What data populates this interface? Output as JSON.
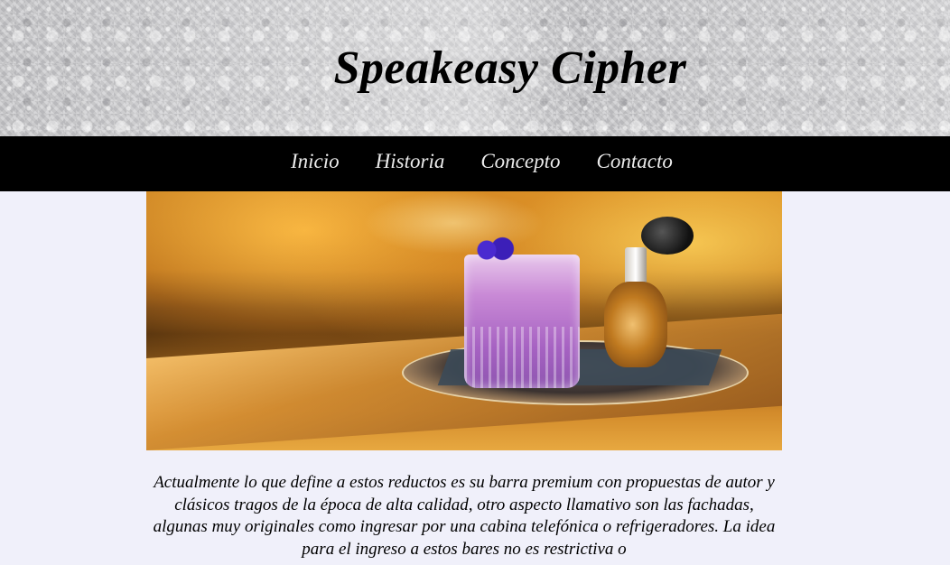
{
  "header": {
    "title": "Speakeasy Cipher"
  },
  "nav": {
    "items": [
      "Inicio",
      "Historia",
      "Concepto",
      "Contacto"
    ]
  },
  "hero": {
    "alt": "Purple cocktail with flower garnish next to a perfume atomizer on a silver tray"
  },
  "content": {
    "paragraph": "Actualmente lo que define a estos reductos es su barra premium con propuestas de autor y clásicos tragos de la época de alta calidad, otro aspecto llamativo son las fachadas, algunas muy originales como ingresar por una cabina telefónica o refrigeradores. La idea para el ingreso a estos bares no es restrictiva o"
  },
  "colors": {
    "nav_bg": "#000000",
    "page_bg": "#f0f0fa",
    "nav_text": "#ececec"
  }
}
